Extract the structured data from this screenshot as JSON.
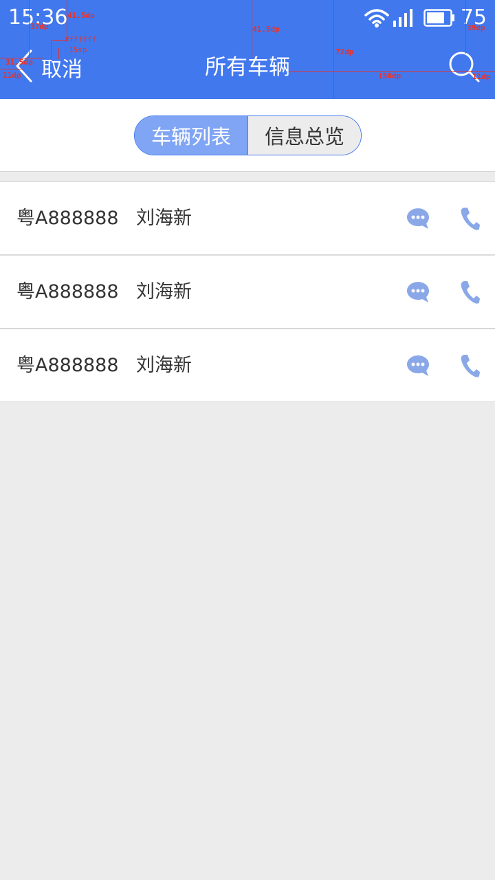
{
  "status_bar": {
    "time": "15:36",
    "battery": "75"
  },
  "nav": {
    "back_label": "取消",
    "title": "所有车辆"
  },
  "annotations": {
    "a1": "41.5dp",
    "a2": "37dp",
    "a3": "#ffffff",
    "a4": "15sp",
    "a5": "31.5dp",
    "a6": "11dp",
    "a7": "41.5dp",
    "a8": "72dp",
    "a9": "150dp",
    "a10": "39dp",
    "a11": "11dp"
  },
  "segment": {
    "active_label": "车辆列表",
    "inactive_label": "信息总览"
  },
  "vehicles": [
    {
      "plate": "粤A888888",
      "driver": "刘海新"
    },
    {
      "plate": "粤A888888",
      "driver": "刘海新"
    },
    {
      "plate": "粤A888888",
      "driver": "刘海新"
    }
  ],
  "colors": {
    "header": "#4278ee",
    "segment_active": "#7fa5f4",
    "action_icon": "#8aa8e8",
    "annotation": "#e6322a"
  }
}
